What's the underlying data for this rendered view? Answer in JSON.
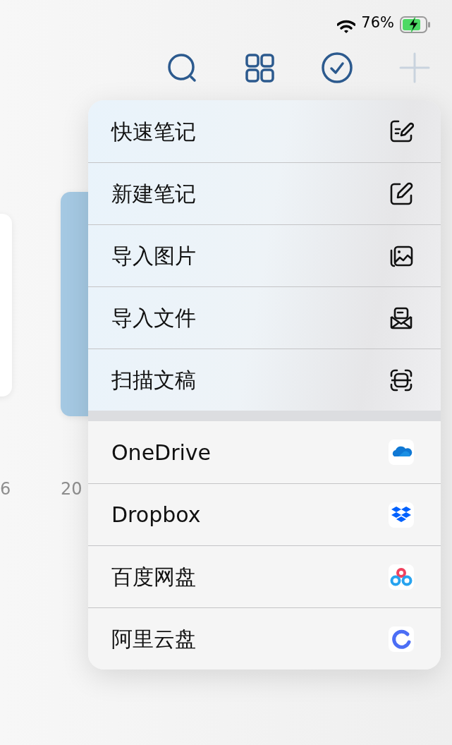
{
  "status_bar": {
    "battery": "76%",
    "charging": true
  },
  "toolbar": [
    {
      "disabled": false
    },
    {
      "disabled": false
    },
    {
      "disabled": false
    },
    {
      "disabled": true
    }
  ],
  "notes": [
    {
      "color": "#ffffff",
      "date": "6"
    },
    {
      "color": "#a5c9e3",
      "date": "20"
    }
  ],
  "menu": {
    "sections": [
      {
        "items": [
          {
            "label": "快速笔记"
          },
          {
            "label": "新建笔记"
          },
          {
            "label": "导入图片"
          },
          {
            "label": "导入文件"
          },
          {
            "label": "扫描文稿"
          }
        ]
      },
      {
        "items": [
          {
            "label": "OneDrive"
          },
          {
            "label": "Dropbox"
          },
          {
            "label": "百度网盘"
          },
          {
            "label": "阿里云盘"
          }
        ]
      }
    ]
  }
}
